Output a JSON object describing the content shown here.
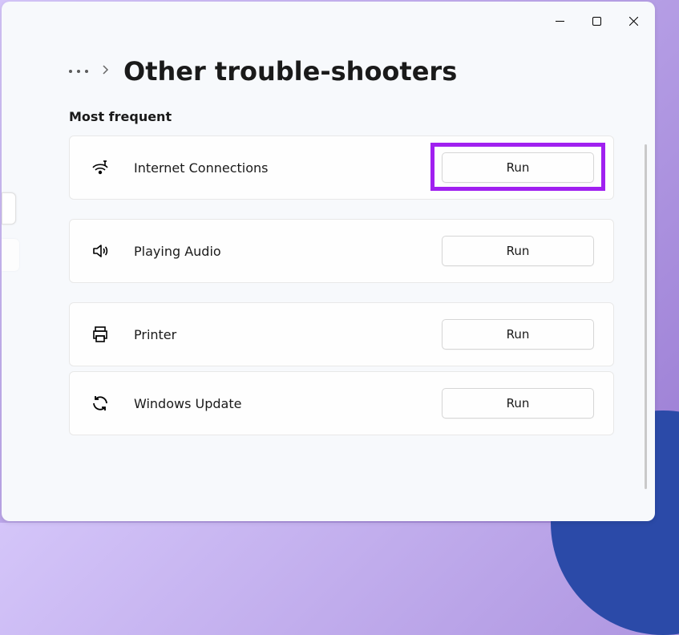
{
  "page": {
    "title": "Other trouble-shooters",
    "section_label": "Most frequent"
  },
  "buttons": {
    "run": "Run"
  },
  "troubleshooters": [
    {
      "label": "Internet Connections",
      "icon": "wifi"
    },
    {
      "label": "Playing Audio",
      "icon": "audio"
    },
    {
      "label": "Printer",
      "icon": "printer"
    },
    {
      "label": "Windows Update",
      "icon": "refresh"
    }
  ]
}
